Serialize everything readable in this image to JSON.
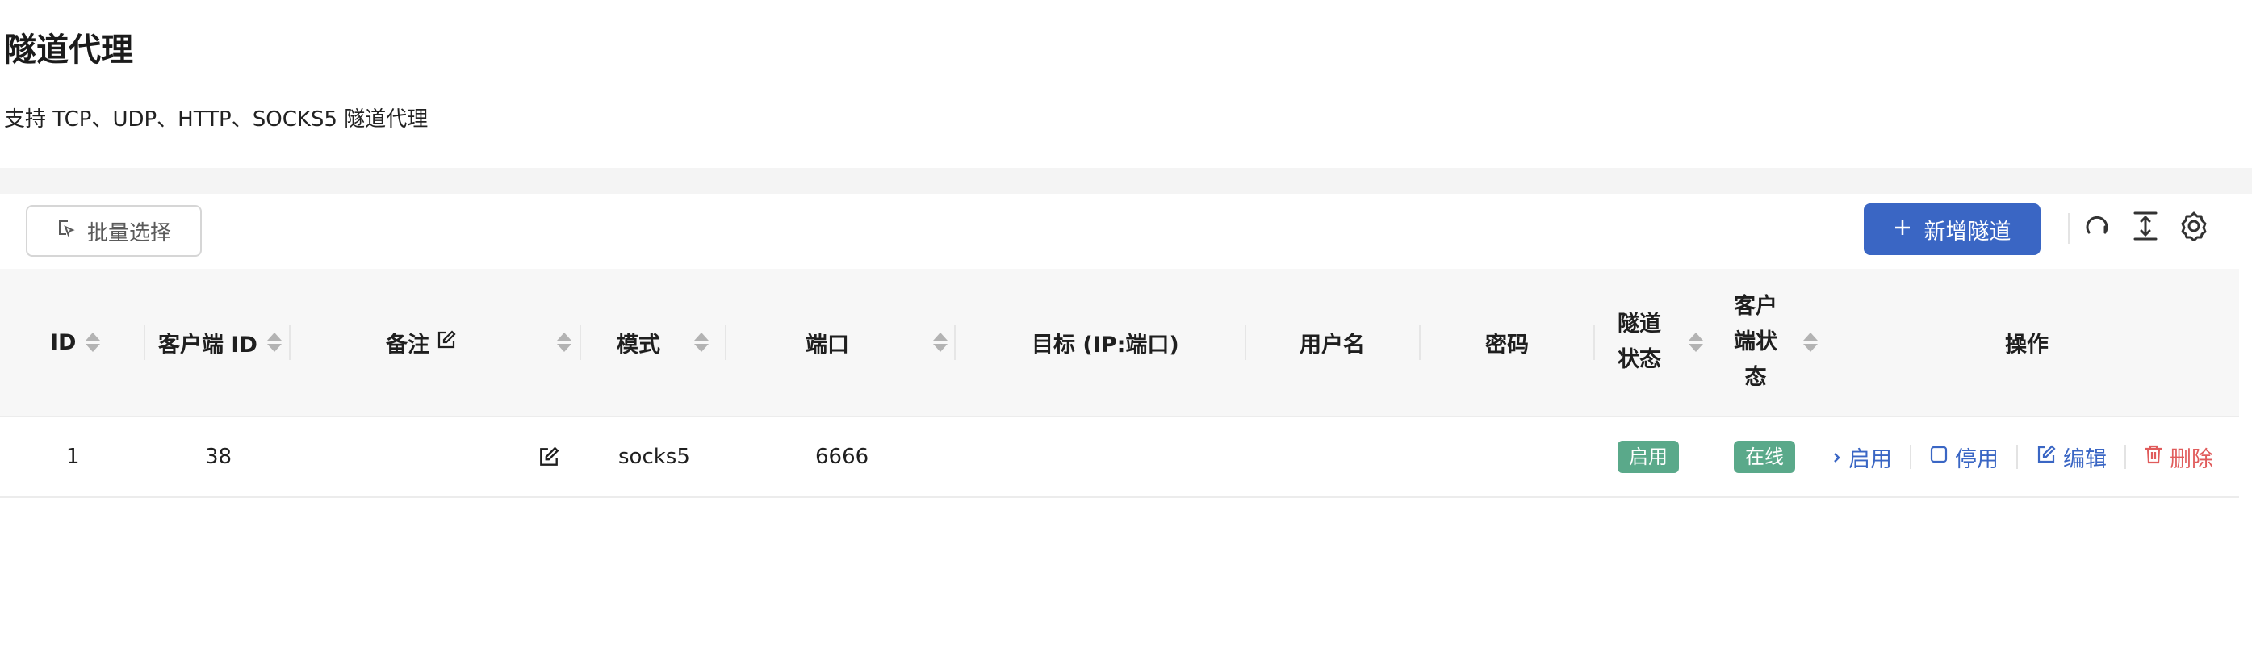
{
  "page": {
    "title": "隧道代理",
    "subtitle": "支持 TCP、UDP、HTTP、SOCKS5 隧道代理"
  },
  "toolbar": {
    "batch_select_label": "批量选择",
    "add_tunnel_label": "新增隧道",
    "icons": [
      "batch-select-icon",
      "plus-icon",
      "refresh-icon",
      "column-height-icon",
      "settings-icon"
    ]
  },
  "table": {
    "columns": {
      "id": "ID",
      "client_id": "客户端 ID",
      "remark": "备注",
      "mode": "模式",
      "port": "端口",
      "target": "目标 (IP:端口)",
      "username": "用户名",
      "password": "密码",
      "tunnel_status_l1": "隧道",
      "tunnel_status_l2": "状态",
      "client_status_l1": "客户",
      "client_status_l2": "端状",
      "client_status_l3": "态",
      "actions": "操作"
    },
    "rows": [
      {
        "id": "1",
        "client_id": "38",
        "remark": "",
        "mode": "socks5",
        "port": "6666",
        "target": "",
        "username": "",
        "password": "",
        "tunnel_status": "启用",
        "client_status": "在线",
        "actions": {
          "enable": "启用",
          "disable": "停用",
          "edit": "编辑",
          "delete": "删除"
        }
      }
    ]
  },
  "colors": {
    "primary": "#3a66c4",
    "tag_green": "#5aa98a",
    "danger": "#e05b5b",
    "header_bg": "#f7f7f7"
  }
}
